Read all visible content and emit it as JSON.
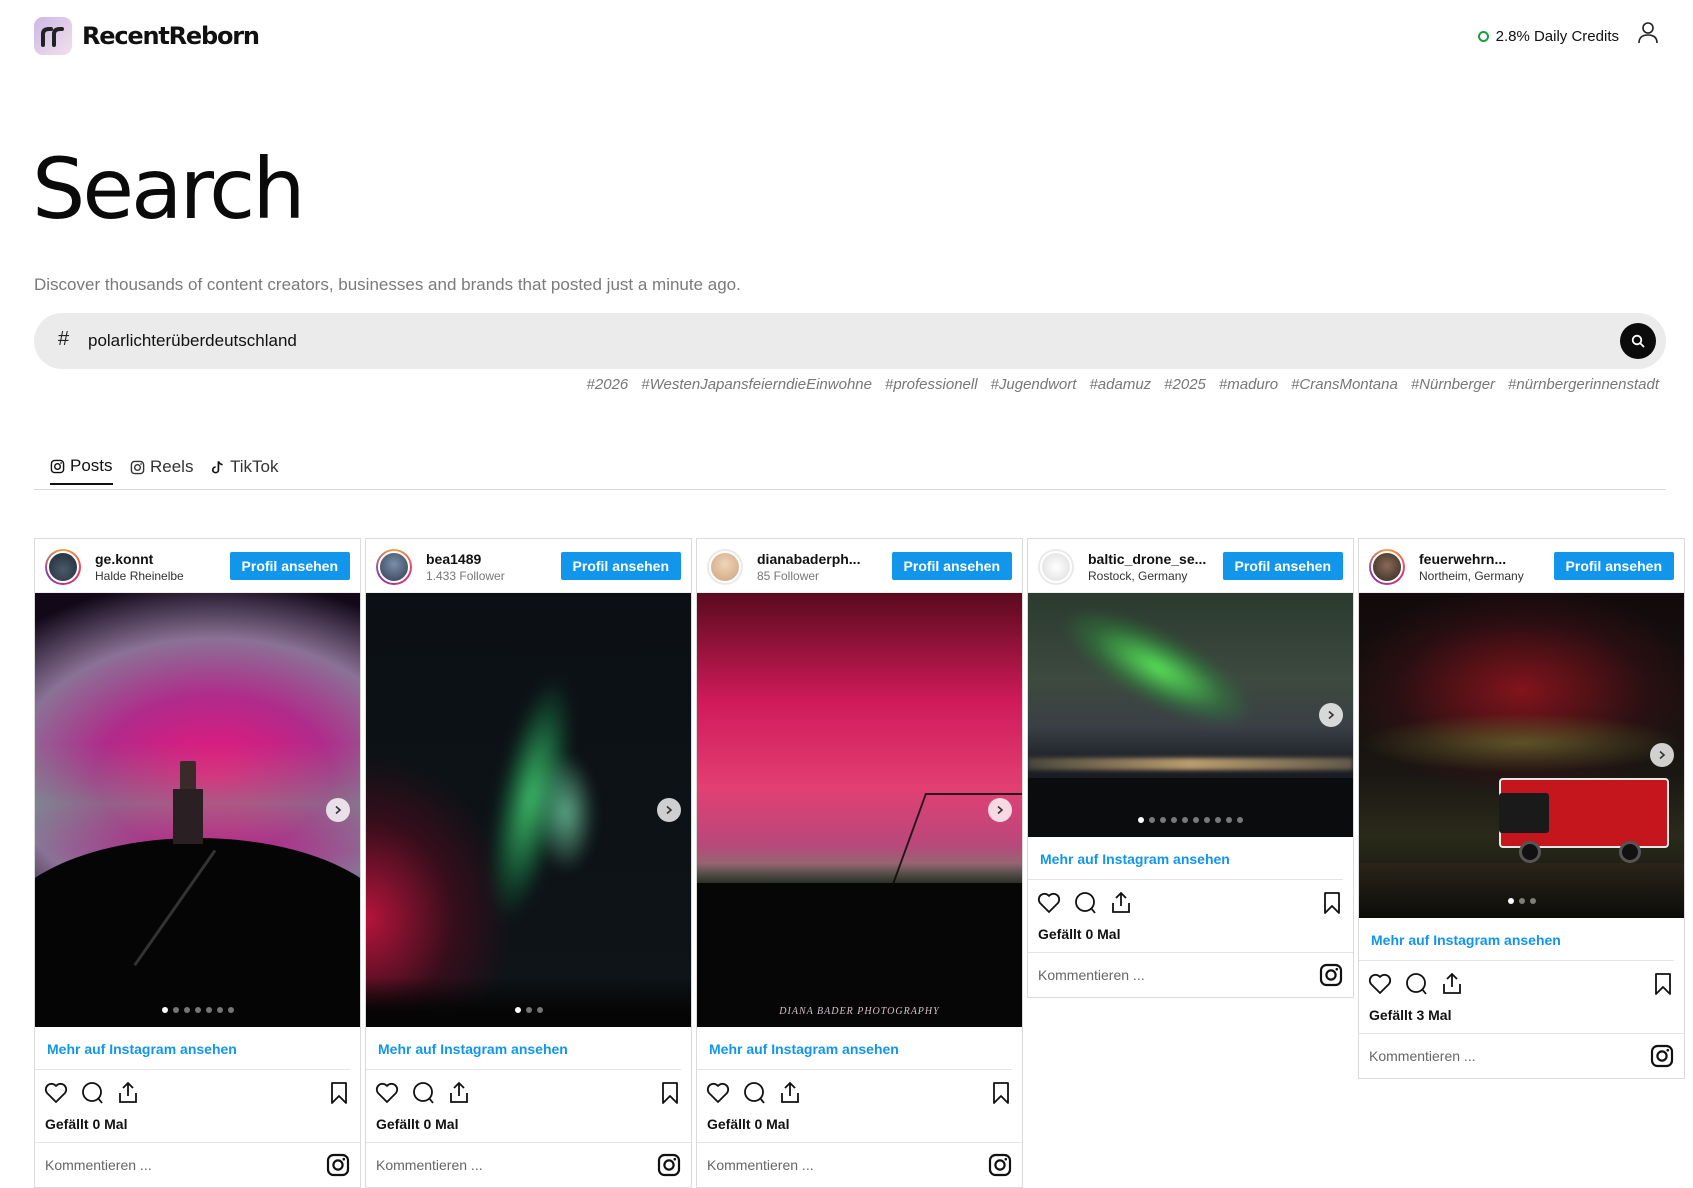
{
  "app": {
    "name": "RecentReborn"
  },
  "header": {
    "credits": "2.8% Daily Credits"
  },
  "page": {
    "title": "Search",
    "subtitle": "Discover thousands of content creators, businesses and brands that posted just a minute ago."
  },
  "search": {
    "prefix": "#",
    "value": "polarlichterüberdeutschland"
  },
  "tags": [
    "#2026",
    "#WestenJapansfeierndieEinwohne",
    "#professionell",
    "#Jugendwort",
    "#adamuz",
    "#2025",
    "#maduro",
    "#CransMontana",
    "#Nürnberger",
    "#nürnbergerinnenstadt"
  ],
  "tabs": [
    {
      "label": "Posts",
      "active": true
    },
    {
      "label": "Reels",
      "active": false
    },
    {
      "label": "TikTok",
      "active": false
    }
  ],
  "card_labels": {
    "profile_button": "Profil ansehen",
    "more_link": "Mehr auf Instagram ansehen",
    "comment_placeholder": "Kommentieren ..."
  },
  "posts": [
    {
      "username": "ge.konnt",
      "subline": "Halde Rheinelbe",
      "likes": "Gefällt 0 Mal",
      "dots": 7,
      "active_dot": 0
    },
    {
      "username": "bea1489",
      "subline": "1.433 Follower",
      "likes": "Gefällt 0 Mal",
      "dots": 3,
      "active_dot": 0
    },
    {
      "username": "dianabaderph...",
      "subline": "85 Follower",
      "likes": "Gefällt 0 Mal",
      "dots": 0,
      "active_dot": 0,
      "watermark": "DIANA BADER PHOTOGRAPHY"
    },
    {
      "username": "baltic_drone_se...",
      "subline": "Rostock, Germany",
      "likes": "Gefällt 0 Mal",
      "dots": 10,
      "active_dot": 0
    },
    {
      "username": "feuerwehrn...",
      "subline": "Northeim, Germany",
      "likes": "Gefällt 3 Mal",
      "dots": 3,
      "active_dot": 0
    }
  ],
  "colors": {
    "accent": "#1296ec",
    "credits_ring": "#1e9e3e",
    "search_bg": "#ebebeb"
  }
}
